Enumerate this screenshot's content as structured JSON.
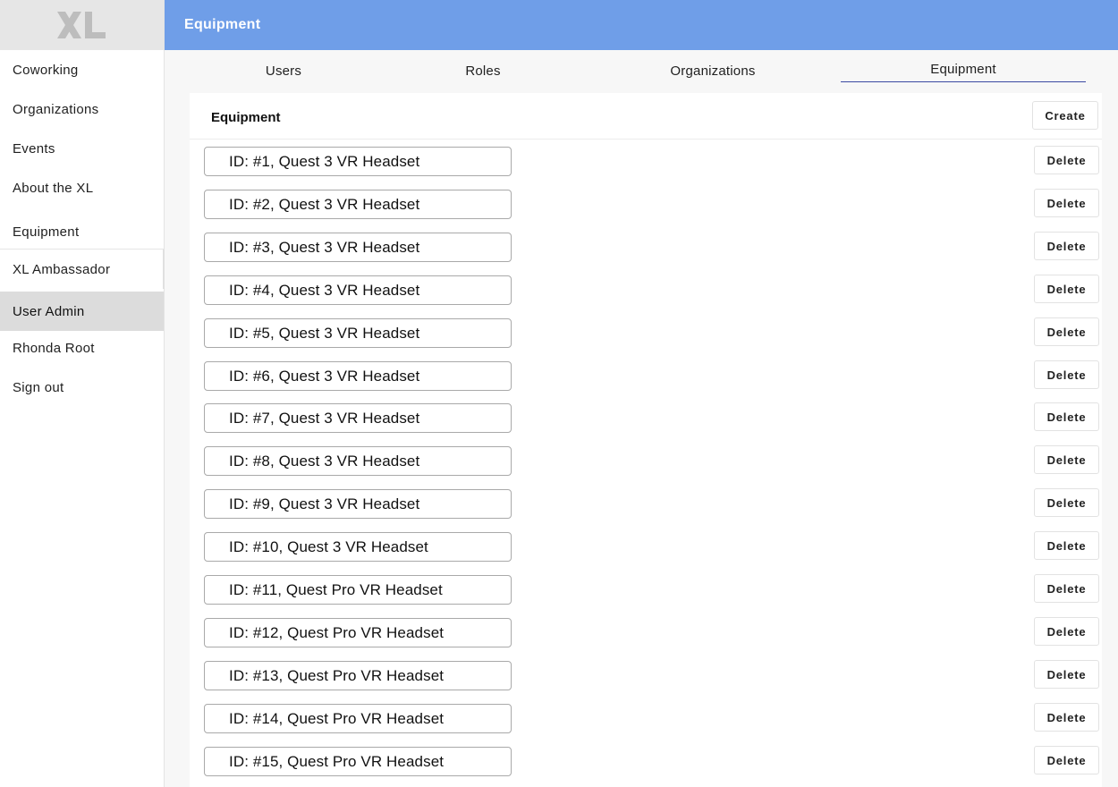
{
  "logo": {
    "text": "XL"
  },
  "header": {
    "title": "Equipment"
  },
  "sidebar": {
    "items": [
      {
        "label": "Coworking"
      },
      {
        "label": "Organizations"
      },
      {
        "label": "Events"
      },
      {
        "label": "About the XL"
      },
      {
        "label": "Equipment"
      },
      {
        "label": "XL Ambassador"
      },
      {
        "label": "User Admin",
        "active": true
      },
      {
        "label": "Rhonda Root"
      },
      {
        "label": "Sign out"
      }
    ]
  },
  "tabs": [
    {
      "label": "Users"
    },
    {
      "label": "Roles"
    },
    {
      "label": "Organizations"
    },
    {
      "label": "Equipment",
      "active": true
    }
  ],
  "card": {
    "title": "Equipment",
    "create_label": "Create",
    "delete_label": "Delete"
  },
  "equipment": [
    {
      "label": "ID: #1, Quest 3 VR Headset"
    },
    {
      "label": "ID: #2, Quest 3 VR Headset"
    },
    {
      "label": "ID: #3, Quest 3 VR Headset"
    },
    {
      "label": "ID: #4, Quest 3 VR Headset"
    },
    {
      "label": "ID: #5, Quest 3 VR Headset"
    },
    {
      "label": "ID: #6, Quest 3 VR Headset"
    },
    {
      "label": "ID: #7, Quest 3 VR Headset"
    },
    {
      "label": "ID: #8, Quest 3 VR Headset"
    },
    {
      "label": "ID: #9, Quest 3 VR Headset"
    },
    {
      "label": "ID: #10, Quest 3 VR Headset"
    },
    {
      "label": "ID: #11, Quest Pro VR Headset"
    },
    {
      "label": "ID: #12, Quest Pro VR Headset"
    },
    {
      "label": "ID: #13, Quest Pro VR Headset"
    },
    {
      "label": "ID: #14, Quest Pro VR Headset"
    },
    {
      "label": "ID: #15, Quest Pro VR Headset"
    }
  ],
  "colors": {
    "header_bg": "#6f9ee8",
    "active_tab_underline": "#3b4aa3",
    "active_sidebar_bg": "#dcdcdc"
  }
}
